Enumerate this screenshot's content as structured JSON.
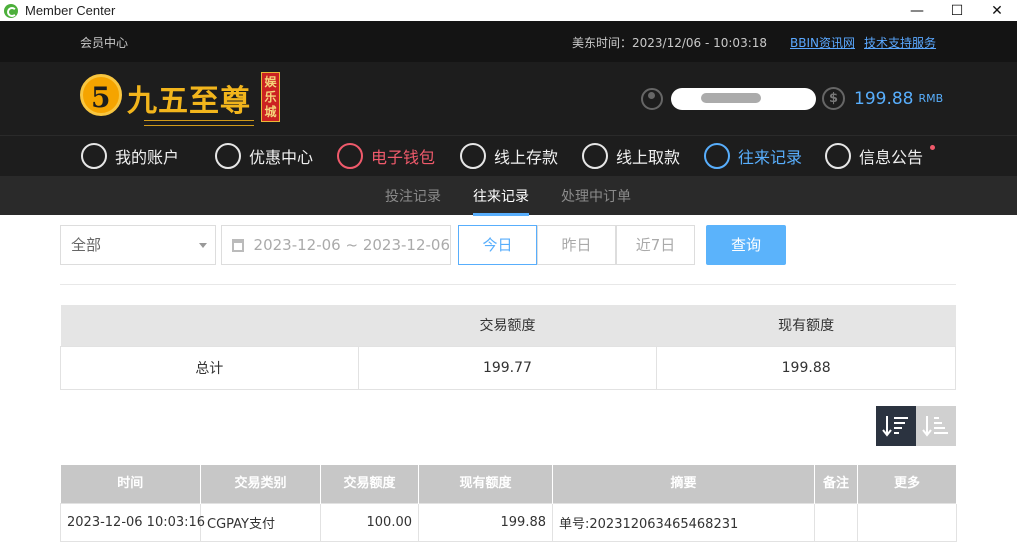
{
  "window": {
    "title": "Member Center",
    "minimize": "—",
    "maximize": "☐",
    "close": "✕"
  },
  "topbar": {
    "home": "会员中心",
    "clock": "美东时间：2023/12/06 - 10:03:18",
    "link1": "BBIN资讯网",
    "link2": "技术支持服务"
  },
  "brand": {
    "logo_mark": "5",
    "name": "九五至尊",
    "tag": "娱乐城",
    "colors": {
      "gold": "#f2b51c",
      "red": "#cc2222"
    }
  },
  "account": {
    "balance": "199.88",
    "currency": "RMB",
    "dollar_symbol": "$"
  },
  "nav": {
    "items": [
      {
        "label": "我的账户",
        "icon": "user-icon"
      },
      {
        "label": "优惠中心",
        "icon": "gift-icon"
      },
      {
        "label": "电子钱包",
        "icon": "wallet-icon"
      },
      {
        "label": "线上存款",
        "icon": "deposit-icon"
      },
      {
        "label": "线上取款",
        "icon": "withdraw-icon"
      },
      {
        "label": "往来记录",
        "icon": "records-icon"
      },
      {
        "label": "信息公告",
        "icon": "bell-icon"
      }
    ]
  },
  "subnav": {
    "items": [
      "投注记录",
      "往来记录",
      "处理中订单"
    ],
    "active": "往来记录"
  },
  "filters": {
    "type_select": "全部",
    "date_range": "2023-12-06 ~ 2023-12-06",
    "quick": [
      "今日",
      "昨日",
      "近7日"
    ],
    "search": "查询"
  },
  "summary": {
    "headers": [
      "",
      "交易额度",
      "现有额度"
    ],
    "row": [
      "总计",
      "199.77",
      "199.88"
    ]
  },
  "records": {
    "headers": [
      "时间",
      "交易类别",
      "交易额度",
      "现有额度",
      "摘要",
      "备注",
      "更多"
    ],
    "rows": [
      [
        "2023-12-06 10:03:16",
        "CGPAY支付",
        "100.00",
        "199.88",
        "单号:202312063465468231",
        "",
        ""
      ]
    ]
  }
}
